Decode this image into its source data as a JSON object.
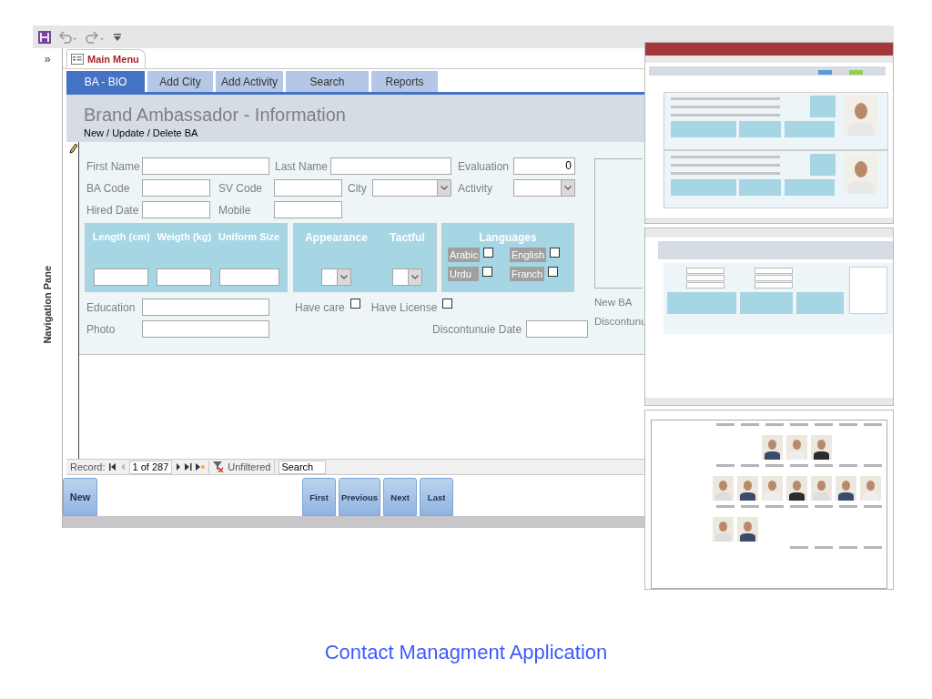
{
  "nav_pane": {
    "toggle": "»",
    "title": "Navigation Pane"
  },
  "document_tab": {
    "title": "Main Menu"
  },
  "tabs": [
    {
      "label": "BA - BIO",
      "selected": true
    },
    {
      "label": "Add City",
      "selected": false
    },
    {
      "label": "Add Activity",
      "selected": false
    },
    {
      "label": "Search",
      "selected": false
    },
    {
      "label": "Reports",
      "selected": false
    }
  ],
  "header": {
    "title": "Brand Ambassador - Information",
    "subtitle": "New / Update / Delete BA"
  },
  "field_rows": [
    [
      {
        "label": "First Name",
        "kind": "text"
      },
      {
        "label": "Last Name",
        "kind": "text"
      },
      {
        "label": "Evaluation",
        "kind": "number",
        "value": "0"
      }
    ],
    [
      {
        "label": "BA Code",
        "kind": "text"
      },
      {
        "label": "SV Code",
        "kind": "text"
      },
      {
        "label": "City",
        "kind": "select"
      },
      {
        "label": "Activity",
        "kind": "select"
      }
    ],
    [
      {
        "label": "Hired Date",
        "kind": "text"
      },
      {
        "label": "Mobile",
        "kind": "text"
      }
    ]
  ],
  "measure_panel": {
    "columns": [
      "Length (cm)",
      "Weigth (kg)",
      "Uniform Size"
    ]
  },
  "rating_panel": {
    "columns": [
      "Appearance",
      "Tactful"
    ]
  },
  "languages_panel": {
    "title": "Languages",
    "items": [
      {
        "label": "Arabic",
        "checked": false
      },
      {
        "label": "English",
        "checked": false
      },
      {
        "label": "Urdu",
        "checked": false
      },
      {
        "label": "Franch",
        "checked": false
      }
    ]
  },
  "lower_rows": [
    [
      {
        "label": "Education",
        "kind": "text"
      },
      {
        "label": "Have care",
        "kind": "checkbox",
        "checked": false
      },
      {
        "label": "Have License",
        "kind": "checkbox",
        "checked": false
      }
    ],
    [
      {
        "label": "Photo",
        "kind": "text"
      },
      {
        "label": "Discontunuie Date",
        "kind": "text"
      }
    ]
  ],
  "side_labels": [
    "New BA",
    "Discontunu"
  ],
  "record_nav": {
    "label": "Record:",
    "position": "1 of 287",
    "filter": "Unfiltered",
    "search_placeholder": "Search"
  },
  "action_buttons": [
    "New"
  ],
  "record_buttons": [
    "First",
    "Previous",
    "Next",
    "Last"
  ],
  "caption": "Contact Managment Application"
}
